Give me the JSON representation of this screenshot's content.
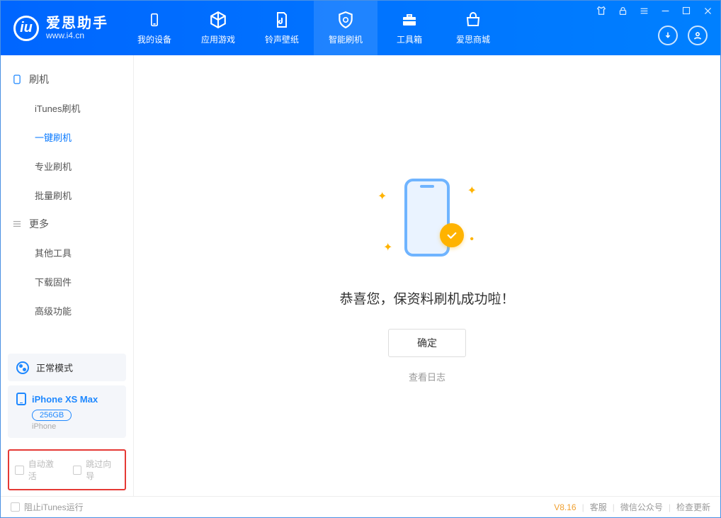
{
  "app": {
    "name": "爱思助手",
    "url": "www.i4.cn"
  },
  "nav": {
    "items": [
      {
        "label": "我的设备"
      },
      {
        "label": "应用游戏"
      },
      {
        "label": "铃声壁纸"
      },
      {
        "label": "智能刷机"
      },
      {
        "label": "工具箱"
      },
      {
        "label": "爱思商城"
      }
    ]
  },
  "sidebar": {
    "section1": {
      "title": "刷机",
      "items": [
        "iTunes刷机",
        "一键刷机",
        "专业刷机",
        "批量刷机"
      ]
    },
    "section2": {
      "title": "更多",
      "items": [
        "其他工具",
        "下载固件",
        "高级功能"
      ]
    },
    "mode": "正常模式",
    "device": {
      "name": "iPhone XS Max",
      "capacity": "256GB",
      "type": "iPhone"
    },
    "checks": {
      "auto_activate": "自动激活",
      "skip_guide": "跳过向导"
    }
  },
  "main": {
    "success_text": "恭喜您，保资料刷机成功啦！",
    "ok_button": "确定",
    "view_log": "查看日志"
  },
  "statusbar": {
    "block_itunes": "阻止iTunes运行",
    "version": "V8.16",
    "links": [
      "客服",
      "微信公众号",
      "检查更新"
    ]
  }
}
